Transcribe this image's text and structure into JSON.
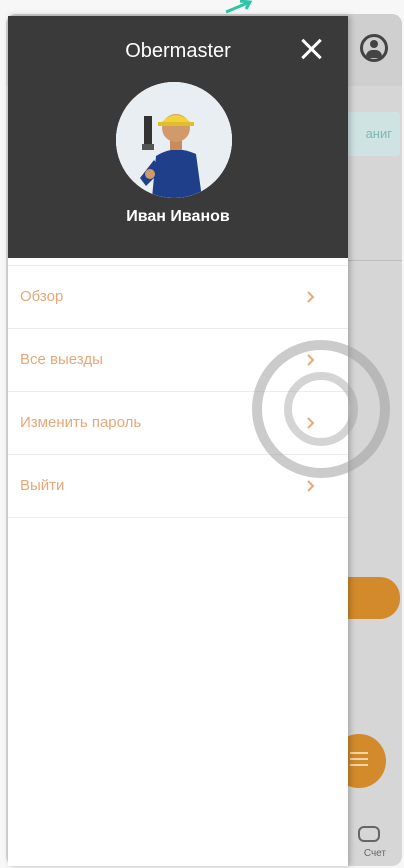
{
  "drawer": {
    "title": "Obermaster",
    "username": "Иван Иванов",
    "close_icon": "close-icon",
    "avatar": "user-photo"
  },
  "menu": {
    "items": [
      {
        "label": "Обзор",
        "icon": "chevron-right-icon"
      },
      {
        "label": "Все выезды",
        "icon": "chevron-right-icon"
      },
      {
        "label": "Изменить пароль",
        "icon": "chevron-right-icon"
      },
      {
        "label": "Выйти",
        "icon": "chevron-right-icon"
      }
    ]
  },
  "background": {
    "tab_fragment": "аниг",
    "bottom_nav_label": "Счет",
    "accent_color": "#d38a2a"
  }
}
